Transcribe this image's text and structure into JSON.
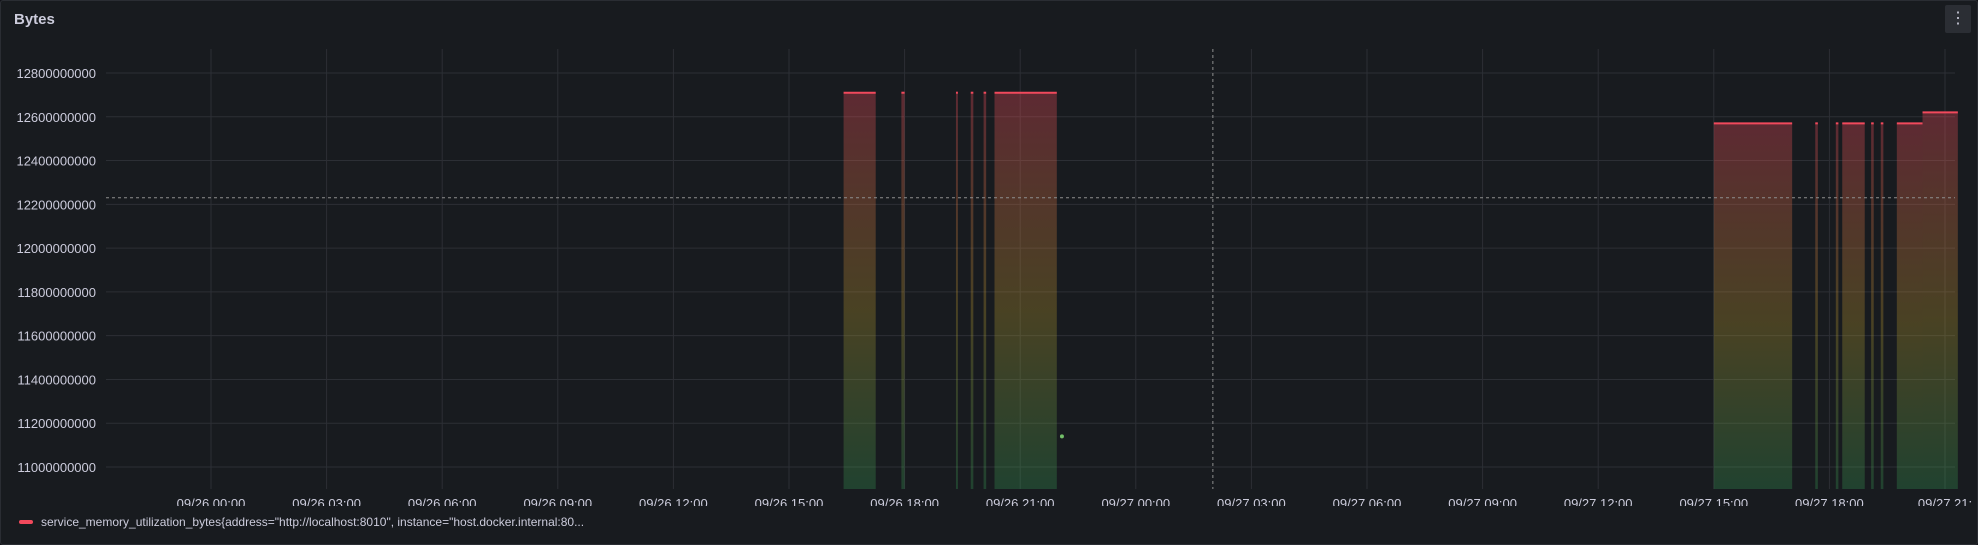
{
  "panel": {
    "title": "Bytes",
    "menu_icon": "vertical-ellipsis-icon"
  },
  "legend": {
    "label": "service_memory_utilization_bytes{address=\"http://localhost:8010\", instance=\"host.docker.internal:80...",
    "color": "#f2495c"
  },
  "chart_data": {
    "type": "area",
    "xlabel": "",
    "ylabel": "",
    "ylim": [
      10900000000,
      12900000000
    ],
    "x_ticks": [
      "09/26 00:00",
      "09/26 03:00",
      "09/26 06:00",
      "09/26 09:00",
      "09/26 12:00",
      "09/26 15:00",
      "09/26 18:00",
      "09/26 21:00",
      "09/27 00:00",
      "09/27 03:00",
      "09/27 06:00",
      "09/27 09:00",
      "09/27 12:00",
      "09/27 15:00",
      "09/27 18:00",
      "09/27 21:"
    ],
    "y_ticks": [
      11000000000,
      11200000000,
      11400000000,
      11600000000,
      11800000000,
      12000000000,
      12200000000,
      12400000000,
      12600000000,
      12800000000
    ],
    "threshold": 12230000000,
    "cursor_time": "09/27 02:00",
    "series": [
      {
        "name": "service_memory_utilization_bytes{address=\"http://localhost:8010\", instance=\"host.docker.internal:80...",
        "color": "#f2495c",
        "segments": [
          {
            "start": "09/26 16:25",
            "end": "09/26 17:15",
            "value": 12710000000
          },
          {
            "start": "09/26 17:55",
            "end": "09/26 18:00",
            "value": 12710000000
          },
          {
            "start": "09/26 19:20",
            "end": "09/26 19:23",
            "value": 12710000000
          },
          {
            "start": "09/26 19:43",
            "end": "09/26 19:47",
            "value": 12710000000
          },
          {
            "start": "09/26 20:03",
            "end": "09/26 20:07",
            "value": 12710000000
          },
          {
            "start": "09/26 20:20",
            "end": "09/26 21:57",
            "value": 12710000000
          },
          {
            "start": "09/27 15:00",
            "end": "09/27 17:02",
            "value": 12570000000
          },
          {
            "start": "09/27 17:38",
            "end": "09/27 17:42",
            "value": 12570000000
          },
          {
            "start": "09/27 18:10",
            "end": "09/27 18:14",
            "value": 12570000000
          },
          {
            "start": "09/27 18:20",
            "end": "09/27 18:55",
            "value": 12570000000
          },
          {
            "start": "09/27 19:05",
            "end": "09/27 19:09",
            "value": 12570000000
          },
          {
            "start": "09/27 19:20",
            "end": "09/27 19:24",
            "value": 12570000000
          },
          {
            "start": "09/27 19:45",
            "end": "09/27 20:25",
            "value": 12570000000
          },
          {
            "start": "09/27 20:25",
            "end": "09/27 21:20",
            "value": 12620000000
          }
        ],
        "points": [
          {
            "time": "09/26 22:05",
            "value": 11140000000
          }
        ]
      }
    ]
  }
}
